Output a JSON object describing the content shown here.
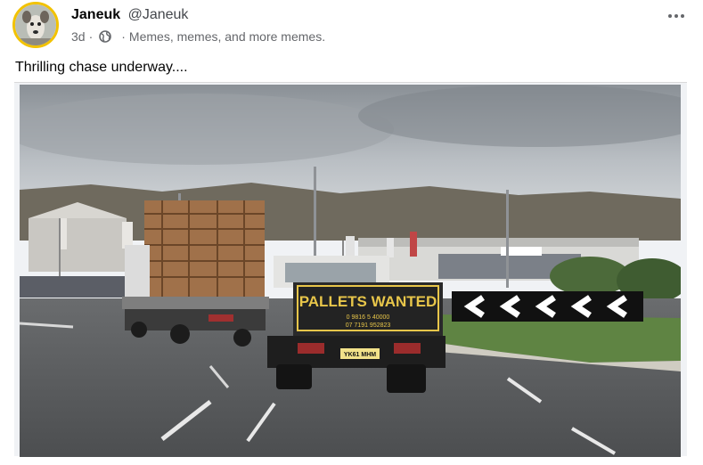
{
  "post": {
    "author_name": "Janeuk",
    "author_handle": "@Janeuk",
    "age": "3d",
    "meta_separator": "·",
    "group_description": "Memes, memes, and more memes.",
    "text": "Thrilling chase underway....",
    "more_label": "•••"
  },
  "photo": {
    "tailgate_sign": "PALLETS WANTED",
    "tailgate_phone_1": "0 9816 5 40000",
    "tailgate_phone_2": "07 7191 952823",
    "number_plate": "YK61 MHM"
  },
  "colors": {
    "avatar_ring": "#f2c200",
    "meta_gray": "#65676b",
    "sign_yellow": "#e8c64a"
  }
}
